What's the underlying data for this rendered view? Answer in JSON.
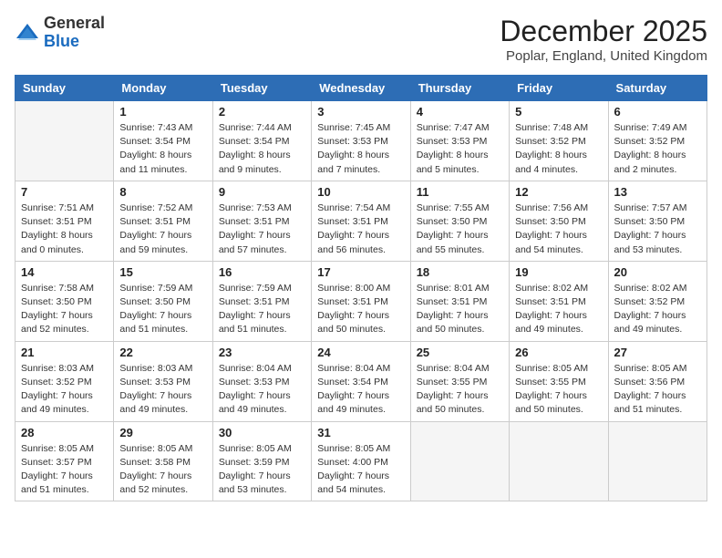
{
  "header": {
    "logo_general": "General",
    "logo_blue": "Blue",
    "title": "December 2025",
    "subtitle": "Poplar, England, United Kingdom"
  },
  "days_of_week": [
    "Sunday",
    "Monday",
    "Tuesday",
    "Wednesday",
    "Thursday",
    "Friday",
    "Saturday"
  ],
  "weeks": [
    [
      {
        "day": "",
        "info": ""
      },
      {
        "day": "1",
        "info": "Sunrise: 7:43 AM\nSunset: 3:54 PM\nDaylight: 8 hours\nand 11 minutes."
      },
      {
        "day": "2",
        "info": "Sunrise: 7:44 AM\nSunset: 3:54 PM\nDaylight: 8 hours\nand 9 minutes."
      },
      {
        "day": "3",
        "info": "Sunrise: 7:45 AM\nSunset: 3:53 PM\nDaylight: 8 hours\nand 7 minutes."
      },
      {
        "day": "4",
        "info": "Sunrise: 7:47 AM\nSunset: 3:53 PM\nDaylight: 8 hours\nand 5 minutes."
      },
      {
        "day": "5",
        "info": "Sunrise: 7:48 AM\nSunset: 3:52 PM\nDaylight: 8 hours\nand 4 minutes."
      },
      {
        "day": "6",
        "info": "Sunrise: 7:49 AM\nSunset: 3:52 PM\nDaylight: 8 hours\nand 2 minutes."
      }
    ],
    [
      {
        "day": "7",
        "info": "Sunrise: 7:51 AM\nSunset: 3:51 PM\nDaylight: 8 hours\nand 0 minutes."
      },
      {
        "day": "8",
        "info": "Sunrise: 7:52 AM\nSunset: 3:51 PM\nDaylight: 7 hours\nand 59 minutes."
      },
      {
        "day": "9",
        "info": "Sunrise: 7:53 AM\nSunset: 3:51 PM\nDaylight: 7 hours\nand 57 minutes."
      },
      {
        "day": "10",
        "info": "Sunrise: 7:54 AM\nSunset: 3:51 PM\nDaylight: 7 hours\nand 56 minutes."
      },
      {
        "day": "11",
        "info": "Sunrise: 7:55 AM\nSunset: 3:50 PM\nDaylight: 7 hours\nand 55 minutes."
      },
      {
        "day": "12",
        "info": "Sunrise: 7:56 AM\nSunset: 3:50 PM\nDaylight: 7 hours\nand 54 minutes."
      },
      {
        "day": "13",
        "info": "Sunrise: 7:57 AM\nSunset: 3:50 PM\nDaylight: 7 hours\nand 53 minutes."
      }
    ],
    [
      {
        "day": "14",
        "info": "Sunrise: 7:58 AM\nSunset: 3:50 PM\nDaylight: 7 hours\nand 52 minutes."
      },
      {
        "day": "15",
        "info": "Sunrise: 7:59 AM\nSunset: 3:50 PM\nDaylight: 7 hours\nand 51 minutes."
      },
      {
        "day": "16",
        "info": "Sunrise: 7:59 AM\nSunset: 3:51 PM\nDaylight: 7 hours\nand 51 minutes."
      },
      {
        "day": "17",
        "info": "Sunrise: 8:00 AM\nSunset: 3:51 PM\nDaylight: 7 hours\nand 50 minutes."
      },
      {
        "day": "18",
        "info": "Sunrise: 8:01 AM\nSunset: 3:51 PM\nDaylight: 7 hours\nand 50 minutes."
      },
      {
        "day": "19",
        "info": "Sunrise: 8:02 AM\nSunset: 3:51 PM\nDaylight: 7 hours\nand 49 minutes."
      },
      {
        "day": "20",
        "info": "Sunrise: 8:02 AM\nSunset: 3:52 PM\nDaylight: 7 hours\nand 49 minutes."
      }
    ],
    [
      {
        "day": "21",
        "info": "Sunrise: 8:03 AM\nSunset: 3:52 PM\nDaylight: 7 hours\nand 49 minutes."
      },
      {
        "day": "22",
        "info": "Sunrise: 8:03 AM\nSunset: 3:53 PM\nDaylight: 7 hours\nand 49 minutes."
      },
      {
        "day": "23",
        "info": "Sunrise: 8:04 AM\nSunset: 3:53 PM\nDaylight: 7 hours\nand 49 minutes."
      },
      {
        "day": "24",
        "info": "Sunrise: 8:04 AM\nSunset: 3:54 PM\nDaylight: 7 hours\nand 49 minutes."
      },
      {
        "day": "25",
        "info": "Sunrise: 8:04 AM\nSunset: 3:55 PM\nDaylight: 7 hours\nand 50 minutes."
      },
      {
        "day": "26",
        "info": "Sunrise: 8:05 AM\nSunset: 3:55 PM\nDaylight: 7 hours\nand 50 minutes."
      },
      {
        "day": "27",
        "info": "Sunrise: 8:05 AM\nSunset: 3:56 PM\nDaylight: 7 hours\nand 51 minutes."
      }
    ],
    [
      {
        "day": "28",
        "info": "Sunrise: 8:05 AM\nSunset: 3:57 PM\nDaylight: 7 hours\nand 51 minutes."
      },
      {
        "day": "29",
        "info": "Sunrise: 8:05 AM\nSunset: 3:58 PM\nDaylight: 7 hours\nand 52 minutes."
      },
      {
        "day": "30",
        "info": "Sunrise: 8:05 AM\nSunset: 3:59 PM\nDaylight: 7 hours\nand 53 minutes."
      },
      {
        "day": "31",
        "info": "Sunrise: 8:05 AM\nSunset: 4:00 PM\nDaylight: 7 hours\nand 54 minutes."
      },
      {
        "day": "",
        "info": ""
      },
      {
        "day": "",
        "info": ""
      },
      {
        "day": "",
        "info": ""
      }
    ]
  ]
}
